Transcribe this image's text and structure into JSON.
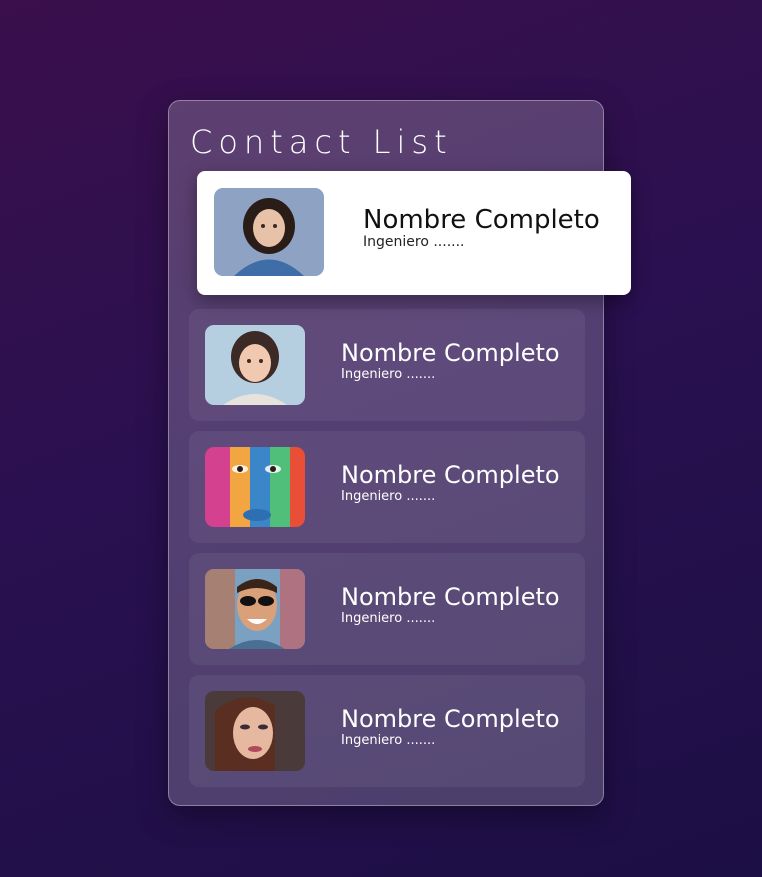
{
  "card": {
    "title": "Contact List"
  },
  "contacts": [
    {
      "name": "Nombre Completo",
      "role": "Ingeniero ......."
    },
    {
      "name": "Nombre Completo",
      "role": "Ingeniero ......."
    },
    {
      "name": "Nombre Completo",
      "role": "Ingeniero ......."
    },
    {
      "name": "Nombre Completo",
      "role": "Ingeniero ......."
    },
    {
      "name": "Nombre Completo",
      "role": "Ingeniero ......."
    }
  ],
  "colors": {
    "background_top": "#3a0f4b",
    "background_bottom": "#1c0f45",
    "card_glass": "rgba(255,255,255,0.20)",
    "active_item": "#ffffff"
  }
}
